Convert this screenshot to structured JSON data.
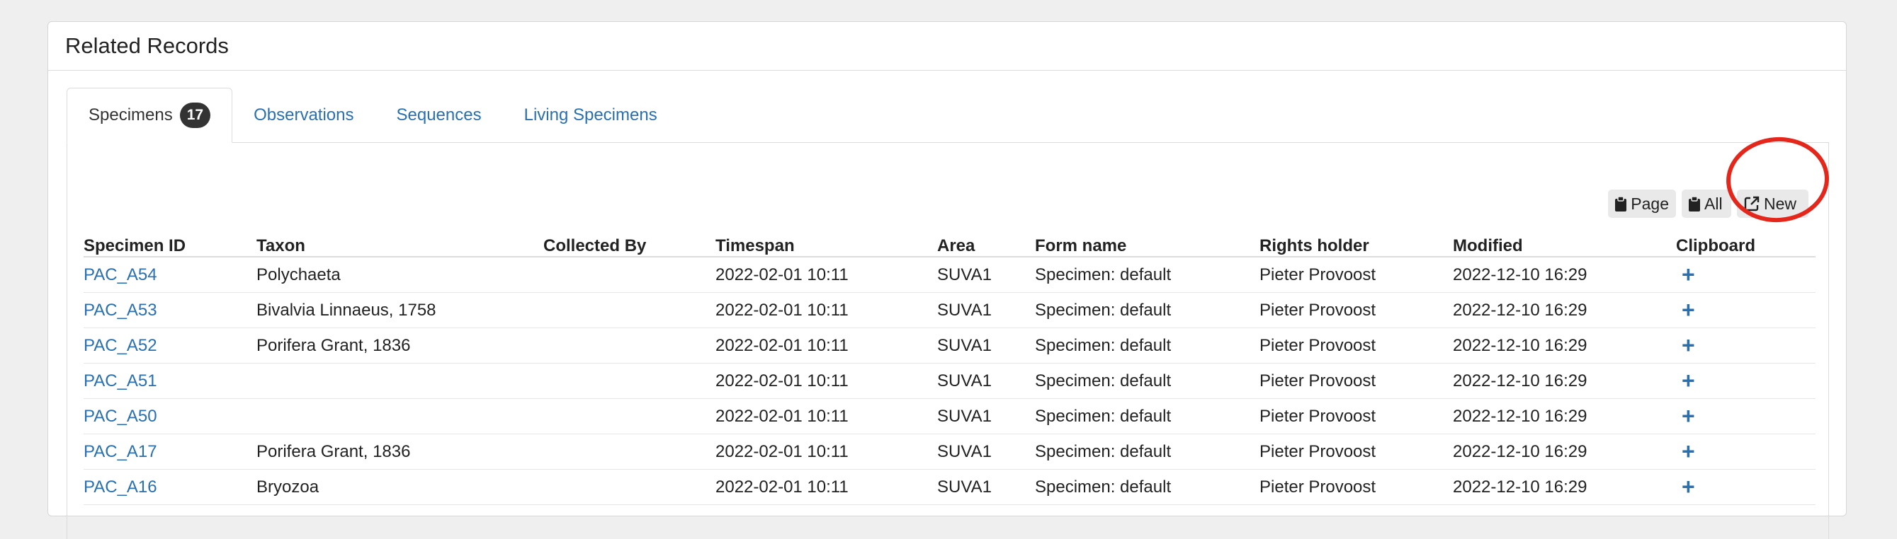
{
  "panel": {
    "title": "Related Records"
  },
  "tabs": [
    {
      "label": "Specimens",
      "count": "17",
      "active": true
    },
    {
      "label": "Observations"
    },
    {
      "label": "Sequences"
    },
    {
      "label": "Living Specimens"
    }
  ],
  "toolbar": {
    "page_label": "Page",
    "all_label": "All",
    "new_label": "New",
    "highlight_color": "#e5261b"
  },
  "table": {
    "headers": [
      "Specimen ID",
      "Taxon",
      "Collected By",
      "Timespan",
      "Area",
      "Form name",
      "Rights holder",
      "Modified",
      "Clipboard"
    ],
    "rows": [
      {
        "id": "PAC_A54",
        "taxon": "Polychaeta",
        "collected_by": "",
        "timespan": "2022-02-01 10:11",
        "area": "SUVA1",
        "form": "Specimen: default",
        "rights": "Pieter Provoost",
        "modified": "2022-12-10 16:29",
        "clip": "+"
      },
      {
        "id": "PAC_A53",
        "taxon": "Bivalvia Linnaeus, 1758",
        "collected_by": "",
        "timespan": "2022-02-01 10:11",
        "area": "SUVA1",
        "form": "Specimen: default",
        "rights": "Pieter Provoost",
        "modified": "2022-12-10 16:29",
        "clip": "+"
      },
      {
        "id": "PAC_A52",
        "taxon": "Porifera Grant, 1836",
        "collected_by": "",
        "timespan": "2022-02-01 10:11",
        "area": "SUVA1",
        "form": "Specimen: default",
        "rights": "Pieter Provoost",
        "modified": "2022-12-10 16:29",
        "clip": "+"
      },
      {
        "id": "PAC_A51",
        "taxon": "",
        "collected_by": "",
        "timespan": "2022-02-01 10:11",
        "area": "SUVA1",
        "form": "Specimen: default",
        "rights": "Pieter Provoost",
        "modified": "2022-12-10 16:29",
        "clip": "+"
      },
      {
        "id": "PAC_A50",
        "taxon": "",
        "collected_by": "",
        "timespan": "2022-02-01 10:11",
        "area": "SUVA1",
        "form": "Specimen: default",
        "rights": "Pieter Provoost",
        "modified": "2022-12-10 16:29",
        "clip": "+"
      },
      {
        "id": "PAC_A17",
        "taxon": "Porifera Grant, 1836",
        "collected_by": "",
        "timespan": "2022-02-01 10:11",
        "area": "SUVA1",
        "form": "Specimen: default",
        "rights": "Pieter Provoost",
        "modified": "2022-12-10 16:29",
        "clip": "+"
      },
      {
        "id": "PAC_A16",
        "taxon": "Bryozoa",
        "collected_by": "",
        "timespan": "2022-02-01 10:11",
        "area": "SUVA1",
        "form": "Specimen: default",
        "rights": "Pieter Provoost",
        "modified": "2022-12-10 16:29",
        "clip": "+"
      }
    ]
  }
}
